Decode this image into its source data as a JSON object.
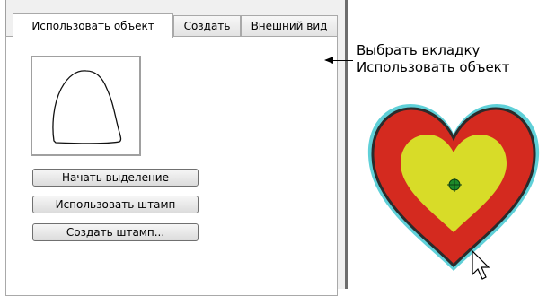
{
  "tabs": [
    {
      "label": "Использовать объект",
      "active": true
    },
    {
      "label": "Создать",
      "active": false
    },
    {
      "label": "Внешний вид",
      "active": false
    }
  ],
  "buttons": {
    "start_selection": "Начать выделение",
    "use_stamp": "Использовать штамп",
    "create_stamp": "Создать штамп..."
  },
  "callout": {
    "line1": "Выбрать вкладку",
    "line2": "Использовать объект"
  },
  "icons": {
    "preview_shape": "bell-outline",
    "center_marker": "crosshair-circle-icon",
    "cursor": "mouse-pointer-icon"
  },
  "colors": {
    "heart_outer": "#d42a1f",
    "heart_inner": "#d8dc28",
    "heart_edge": "#2b2b2b",
    "heart_glow": "#5fd0d8",
    "marker": "#1d8a2a"
  }
}
